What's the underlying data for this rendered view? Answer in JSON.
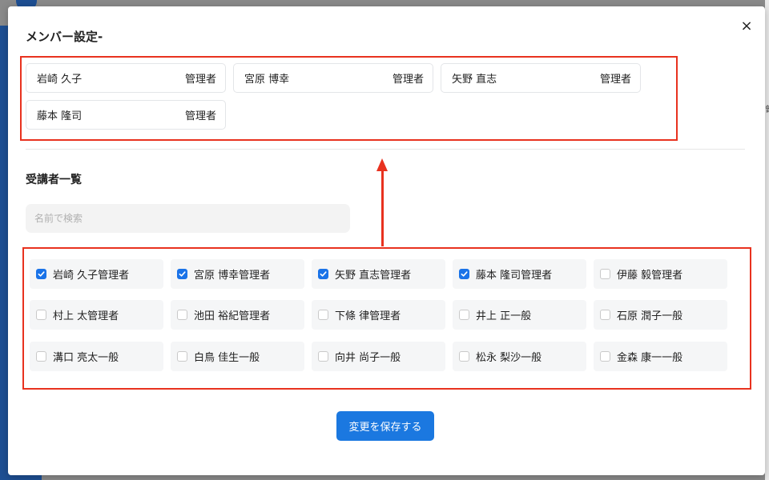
{
  "modal": {
    "title": "メンバー設定-",
    "close_icon": "×"
  },
  "members": [
    {
      "name": "岩崎 久子",
      "role": "管理者"
    },
    {
      "name": "宮原 博幸",
      "role": "管理者"
    },
    {
      "name": "矢野 直志",
      "role": "管理者"
    },
    {
      "name": "藤本 隆司",
      "role": "管理者"
    }
  ],
  "students_section": {
    "title": "受講者一覧",
    "search_placeholder": "名前で検索",
    "students": [
      {
        "label": "岩崎 久子管理者",
        "checked": true
      },
      {
        "label": "宮原 博幸管理者",
        "checked": true
      },
      {
        "label": "矢野 直志管理者",
        "checked": true
      },
      {
        "label": "藤本 隆司管理者",
        "checked": true
      },
      {
        "label": "伊藤 毅管理者",
        "checked": false
      },
      {
        "label": "村上 太管理者",
        "checked": false
      },
      {
        "label": "池田 裕紀管理者",
        "checked": false
      },
      {
        "label": "下條 律管理者",
        "checked": false
      },
      {
        "label": "井上 正一般",
        "checked": false
      },
      {
        "label": "石原 潤子一般",
        "checked": false
      },
      {
        "label": "溝口 亮太一般",
        "checked": false
      },
      {
        "label": "白鳥 佳生一般",
        "checked": false
      },
      {
        "label": "向井 尚子一般",
        "checked": false
      },
      {
        "label": "松永 梨沙一般",
        "checked": false
      },
      {
        "label": "金森 康一一般",
        "checked": false
      }
    ]
  },
  "save_button": "変更を保存する",
  "colors": {
    "accent": "#1b78e0",
    "highlight": "#e8321f"
  },
  "background": {
    "right_edge_text": "曾"
  }
}
